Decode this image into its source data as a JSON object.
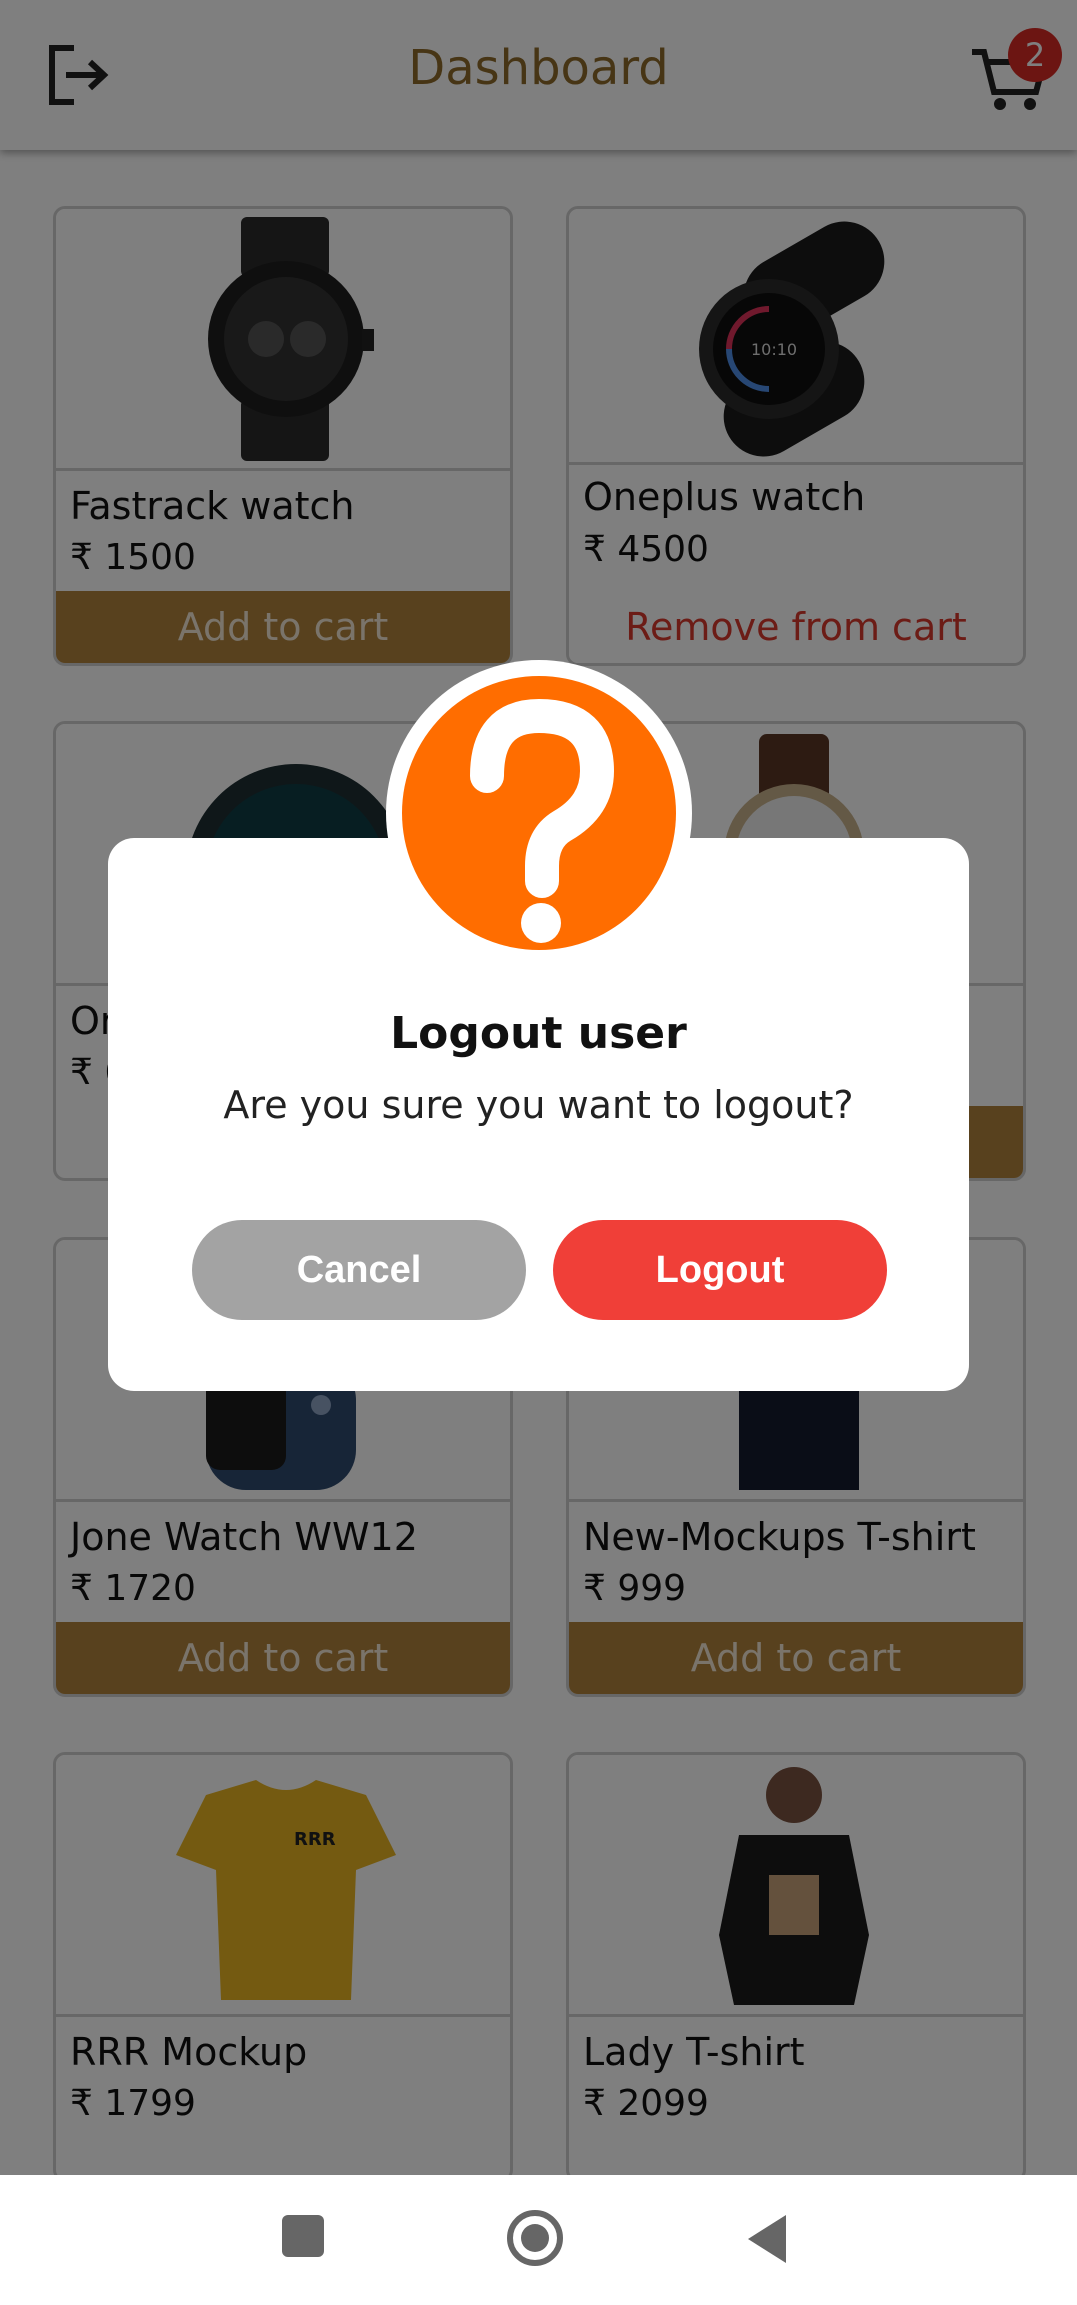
{
  "header": {
    "title": "Dashboard",
    "cart_count": "2",
    "icons": [
      "logout-icon",
      "cart-icon"
    ]
  },
  "products": [
    {
      "name": "Fastrack watch",
      "price": "₹ 1500",
      "action": "Add to cart"
    },
    {
      "name": "Oneplus watch",
      "price": "₹ 4500",
      "action": "Remove from cart"
    },
    {
      "name": "Or",
      "price": "₹ 6"
    },
    {
      "name": "",
      "price": ""
    },
    {
      "name": "Jone Watch WW12",
      "price": "₹ 1720",
      "action": "Add to cart"
    },
    {
      "name": "New-Mockups T-shirt",
      "price": "₹ 999",
      "action": "Add to cart"
    },
    {
      "name": "RRR Mockup",
      "price": "₹ 1799"
    },
    {
      "name": "Lady T-shirt",
      "price": "₹ 2099"
    }
  ],
  "dialog": {
    "title": "Logout user",
    "message": "Are you sure you want to logout?",
    "cancel_label": "Cancel",
    "confirm_label": "Logout",
    "icon": "question-icon"
  },
  "colors": {
    "accent": "#b0823c",
    "dialog_icon": "#ff6d00",
    "confirm": "#f03f38",
    "cancel": "#a3a3a3",
    "remove_text": "#d9382d",
    "badge": "#d82b24"
  },
  "navbar": {
    "icons": [
      "recents-icon",
      "home-icon",
      "back-icon"
    ]
  }
}
